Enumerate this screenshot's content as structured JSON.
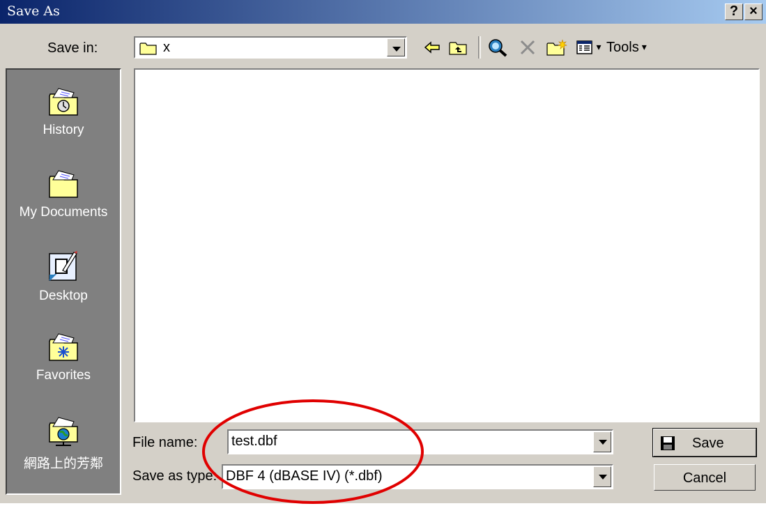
{
  "window": {
    "title": "Save As",
    "help_label": "?",
    "close_label": "×"
  },
  "toolbar": {
    "save_in_label": "Save in:",
    "location_value": "x",
    "tools_label": "Tools",
    "tools_arrow": "▾",
    "views_arrow": "▾"
  },
  "places": [
    {
      "label": "History",
      "icon": "history-icon"
    },
    {
      "label": "My Documents",
      "icon": "my-documents-icon"
    },
    {
      "label": "Desktop",
      "icon": "desktop-icon"
    },
    {
      "label": "Favorites",
      "icon": "favorites-icon"
    },
    {
      "label": "網路上的芳鄰",
      "icon": "network-places-icon"
    }
  ],
  "form": {
    "file_name_label": "File name:",
    "file_name_value": "test.dbf",
    "save_as_type_label": "Save as type:",
    "save_as_type_value": "DBF 4 (dBASE IV) (*.dbf)"
  },
  "buttons": {
    "save_label": "Save",
    "cancel_label": "Cancel"
  },
  "colors": {
    "titlebar_start": "#0a246a",
    "titlebar_end": "#a6caf0",
    "annotation": "#e00000",
    "face": "#d4d0c8"
  }
}
